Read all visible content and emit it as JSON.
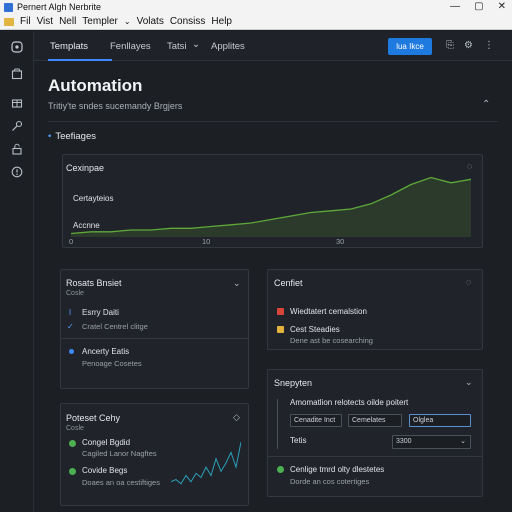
{
  "window": {
    "title": "Pernert Algh Nerbrite",
    "controls": [
      "—",
      "▢",
      "✕"
    ]
  },
  "menu": [
    "Fil",
    "Vist",
    "Nell",
    "Templer",
    "Volats",
    "Consiss",
    "Help"
  ],
  "rail_icons": [
    "app-icon",
    "store-icon",
    "gift-icon",
    "key-icon",
    "lock-icon",
    "alert-icon"
  ],
  "toolbar": {
    "tabs": [
      "Templats",
      "Fenllayes",
      "Tatsi",
      "Applites"
    ],
    "tab_chevron": "⌄",
    "primary_button": "lua Ikce",
    "icon_labels": [
      "⎘",
      "⚙",
      "⋮"
    ]
  },
  "page": {
    "title": "Automation",
    "subtitle": "Tritiy'te sndes sucemandy Brgjers",
    "section_label": "Teefiages"
  },
  "chart_card": {
    "title": "Cexinpae",
    "series_labels": [
      "Certayteios",
      "Accnne"
    ],
    "x_ticks": [
      "0",
      "10",
      "30"
    ]
  },
  "chart_data": {
    "type": "area",
    "title": "Cexinpae",
    "x": [
      0,
      2,
      4,
      6,
      8,
      10,
      12,
      14,
      16,
      18,
      20,
      22,
      24,
      26,
      28,
      30,
      32,
      34,
      36,
      38,
      40
    ],
    "series": [
      {
        "name": "Accnne",
        "values": [
          2,
          3,
          3,
          4,
          4,
          5,
          5,
          6,
          7,
          8,
          10,
          12,
          14,
          15,
          16,
          19,
          24,
          30,
          34,
          31,
          33
        ]
      }
    ],
    "xlim": [
      0,
      40
    ],
    "ylim": [
      0,
      40
    ],
    "colors": {
      "line": "#5fa83a",
      "fill": "#2b3a2a"
    }
  },
  "card_a": {
    "title": "Rosats Bnsiet",
    "subtitle": "Cosle",
    "items": [
      {
        "label": "Esrry Daiti",
        "sub": ""
      },
      {
        "label": "",
        "sub": "Cratel Centrel clitge"
      },
      {
        "label": "Ancerty Eatis",
        "sub": "Penoage Cosetes"
      }
    ]
  },
  "card_b": {
    "title": "Cenfiet",
    "items": [
      {
        "label": "Wiedtatert cemalstion",
        "sub": "",
        "color": "#d9453b"
      },
      {
        "label": "Cest Steadies",
        "sub": "Dene ast be cosearching",
        "color": "#e3b33b"
      }
    ]
  },
  "card_c": {
    "title": "Poteset Cehy",
    "subtitle": "Cosle",
    "items": [
      {
        "label": "Congel Bgdid",
        "sub": "Cagiled Lanor Nagftes"
      },
      {
        "label": "Covide Begs",
        "sub": "Doaes an oa cestiftiges"
      }
    ]
  },
  "mini_chart": {
    "values": [
      3,
      4,
      2,
      6,
      3,
      7,
      5,
      10,
      6,
      14,
      8,
      12,
      17,
      10,
      22
    ]
  },
  "card_d": {
    "title": "Snepyten",
    "heading": "Amomatlion relotects oilde poitert",
    "fields": [
      "Cenadite Inct",
      "Cemelates",
      "Olglea"
    ],
    "select_label": "Tetis",
    "select_value": "3300",
    "footer_label": "Cenlige tmrd olty dlestetes",
    "footer_sub": "Dorde an cos cotertiges"
  }
}
